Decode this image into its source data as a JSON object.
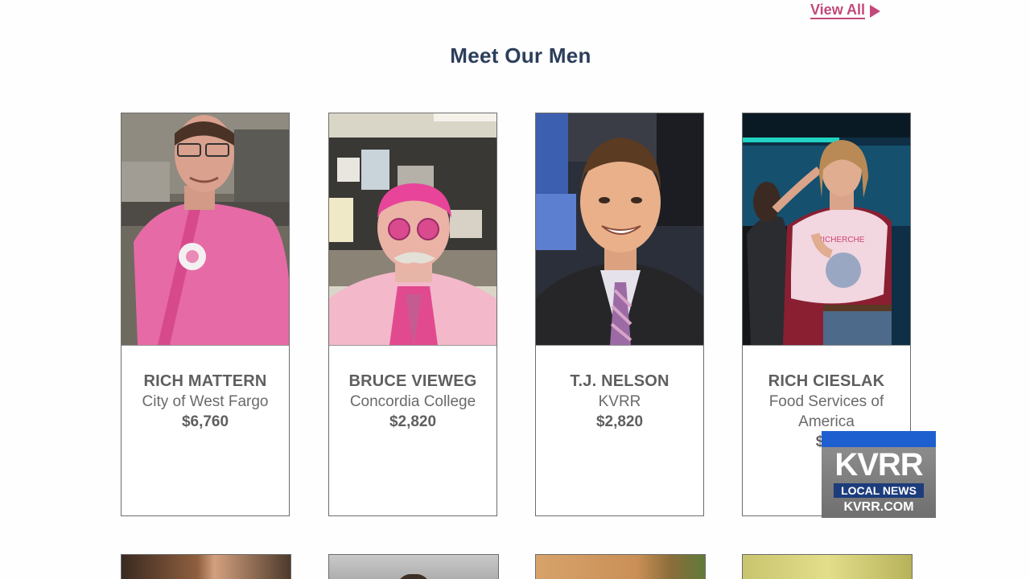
{
  "header": {
    "view_all_label": "View All",
    "section_title": "Meet Our Men"
  },
  "cards": [
    {
      "name": "RICH MATTERN",
      "org": "City of West Fargo",
      "amount": "$6,760"
    },
    {
      "name": "BRUCE VIEWEG",
      "org": "Concordia College",
      "amount": "$2,820"
    },
    {
      "name": "T.J. NELSON",
      "org": "KVRR",
      "amount": "$2,820"
    },
    {
      "name": "RICH CIESLAK",
      "org": "Food Services of America",
      "amount": "$2,"
    }
  ],
  "watermark": {
    "brand": "KVRR",
    "tagline": "LOCAL NEWS",
    "site": "KVRR.COM"
  },
  "colors": {
    "accent_pink": "#c2497a",
    "title_navy": "#2c3e5a",
    "bug_blue": "#1e5fcf"
  }
}
